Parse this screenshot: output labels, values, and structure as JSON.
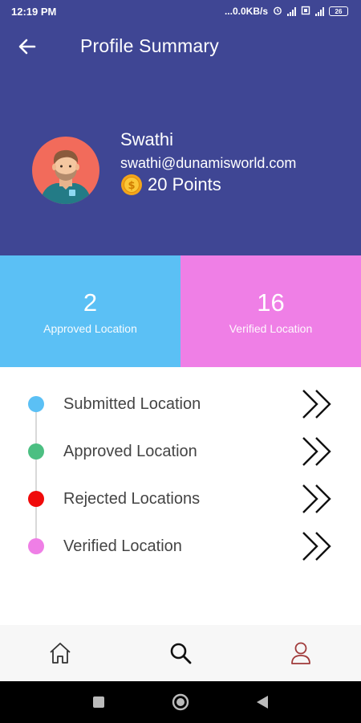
{
  "status_bar": {
    "time": "12:19 PM",
    "network_speed": "...0.0KB/s",
    "battery": "26"
  },
  "header": {
    "title": "Profile Summary",
    "back_icon": "arrow-left-icon",
    "background_color": "#3f4694"
  },
  "profile": {
    "name": "Swathi",
    "email": "swathi@dunamisworld.com",
    "points": "20 Points",
    "coin_icon": "dollar-coin-icon"
  },
  "stats": [
    {
      "value": "2",
      "label": "Approved Location",
      "color": "#5bc0f5"
    },
    {
      "value": "16",
      "label": "Verified Location",
      "color": "#ef7fe6"
    }
  ],
  "locations": [
    {
      "label": "Submitted Location",
      "dot_color": "#5bc0f5"
    },
    {
      "label": "Approved Location",
      "dot_color": "#4cbf82"
    },
    {
      "label": "Rejected Locations",
      "dot_color": "#f00a0a"
    },
    {
      "label": "Verified Location",
      "dot_color": "#ef7fe6"
    }
  ],
  "bottom_nav": [
    {
      "icon": "home-icon"
    },
    {
      "icon": "search-icon"
    },
    {
      "icon": "user-icon"
    }
  ],
  "system_nav": [
    {
      "icon": "recents-square-icon"
    },
    {
      "icon": "home-circle-icon"
    },
    {
      "icon": "back-triangle-icon"
    }
  ]
}
